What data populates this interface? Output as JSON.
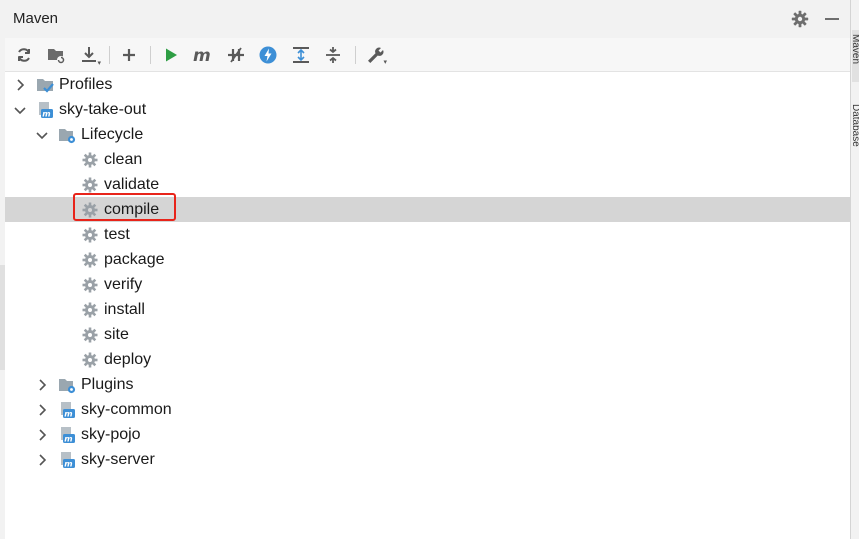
{
  "panel": {
    "title": "Maven"
  },
  "toolbar": {
    "buttons": [
      {
        "icon": "reload-icon"
      },
      {
        "icon": "generate-sources-icon"
      },
      {
        "icon": "download-icon"
      },
      {
        "icon": "add-icon"
      },
      {
        "icon": "run-icon"
      },
      {
        "icon": "maven-goal-icon"
      },
      {
        "icon": "toggle-offline-icon"
      },
      {
        "icon": "skip-tests-icon"
      },
      {
        "icon": "show-dependencies-icon"
      },
      {
        "icon": "collapse-all-icon"
      },
      {
        "icon": "settings-wrench-icon"
      }
    ]
  },
  "tree": {
    "profiles": "Profiles",
    "project": "sky-take-out",
    "lifecycle": "Lifecycle",
    "goals": [
      "clean",
      "validate",
      "compile",
      "test",
      "package",
      "verify",
      "install",
      "site",
      "deploy"
    ],
    "plugins": "Plugins",
    "modules": [
      "sky-common",
      "sky-pojo",
      "sky-server"
    ]
  },
  "selection": {
    "selected_goal": "compile"
  },
  "right_sidebar": {
    "tabs": [
      "Maven",
      "Database"
    ]
  },
  "colors": {
    "highlight_border": "#e8241a",
    "selection_bg": "#d5d5d5",
    "run_green": "#2e9e44",
    "maven_blue": "#3d8fd6"
  }
}
